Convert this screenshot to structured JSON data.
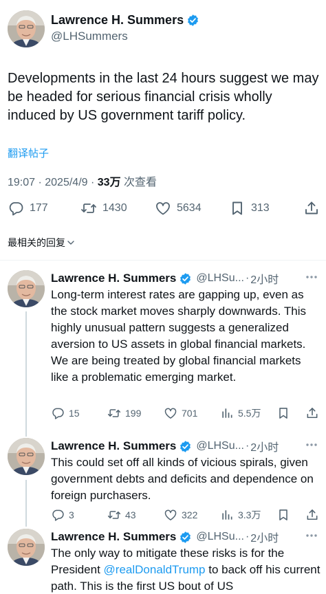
{
  "main_tweet": {
    "author_name": "Lawrence H. Summers",
    "handle": "@LHSummers",
    "text": "Developments in the last 24 hours suggest we may be headed for serious financial crisis wholly induced by US government tariff policy.",
    "translate_label": "翻译帖子",
    "timestamp": "19:07 · 2025/4/9 · ",
    "views_count": "33万",
    "views_label": " 次查看",
    "replies": "177",
    "reposts": "1430",
    "likes": "5634",
    "bookmarks": "313"
  },
  "sort_label": "最相关的回复",
  "replies": [
    {
      "author_name": "Lawrence H. Summers",
      "handle": "@LHSu...",
      "time": "2小时",
      "text": "Long-term interest rates are gapping up, even as the stock market moves sharply downwards. This highly unusual pattern suggests a generalized aversion to US assets in global financial markets.  We are being treated by global financial markets like a problematic emerging market.",
      "replies": "15",
      "reposts": "199",
      "likes": "701",
      "views": "5.5万"
    },
    {
      "author_name": "Lawrence H. Summers",
      "handle": "@LHSu...",
      "time": "2小时",
      "text": "This could set off all kinds of vicious spirals, given government debts and deficits and dependence on foreign purchasers.",
      "replies": "3",
      "reposts": "43",
      "likes": "322",
      "views": "3.3万"
    },
    {
      "author_name": "Lawrence H. Summers",
      "handle": "@LHSu...",
      "time": "2小时",
      "text_before": "The only way to mitigate these risks is for the President ",
      "mention": "@realDonaldTrump",
      "text_after": " to back off his current path. This is the first US bout of US"
    }
  ],
  "icons": {
    "verified": "verified-badge-icon",
    "reply": "reply-icon",
    "repost": "repost-icon",
    "like": "heart-icon",
    "bookmark": "bookmark-icon",
    "share": "share-icon",
    "views": "views-bar-icon",
    "more": "more-dots-icon",
    "chevron": "chevron-down-icon"
  },
  "colors": {
    "accent": "#1d9bf0",
    "text": "#0f1419",
    "secondary": "#536471"
  }
}
